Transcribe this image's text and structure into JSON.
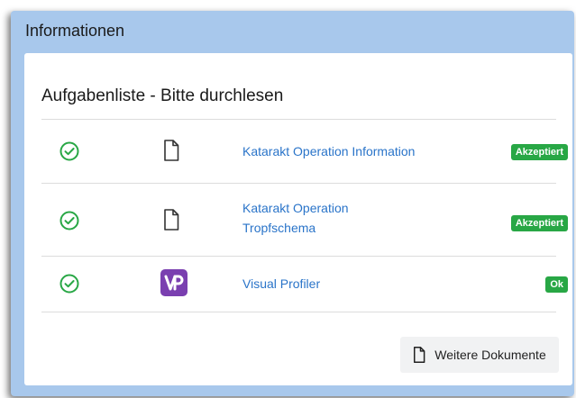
{
  "panel": {
    "title": "Informationen"
  },
  "card": {
    "title": "Aufgabenliste - Bitte durchlesen"
  },
  "items": [
    {
      "status_icon": "check-circle-icon",
      "type_icon": "file-icon",
      "link_lines": [
        "Katarakt Operation Information"
      ],
      "badge": "Akzeptiert"
    },
    {
      "status_icon": "check-circle-icon",
      "type_icon": "file-icon",
      "link_lines": [
        "Katarakt Operation",
        "Tropfschema"
      ],
      "badge": "Akzeptiert"
    },
    {
      "status_icon": "check-circle-icon",
      "type_icon": "visual-profiler-logo",
      "link_lines": [
        "Visual Profiler"
      ],
      "badge": "Ok"
    }
  ],
  "more_button": {
    "label": "Weitere Dokumente",
    "icon": "file-icon"
  },
  "colors": {
    "panel_bg": "#a8c8ec",
    "link": "#2a74c9",
    "success": "#28a745",
    "vp_purple": "#7a3fb0"
  }
}
